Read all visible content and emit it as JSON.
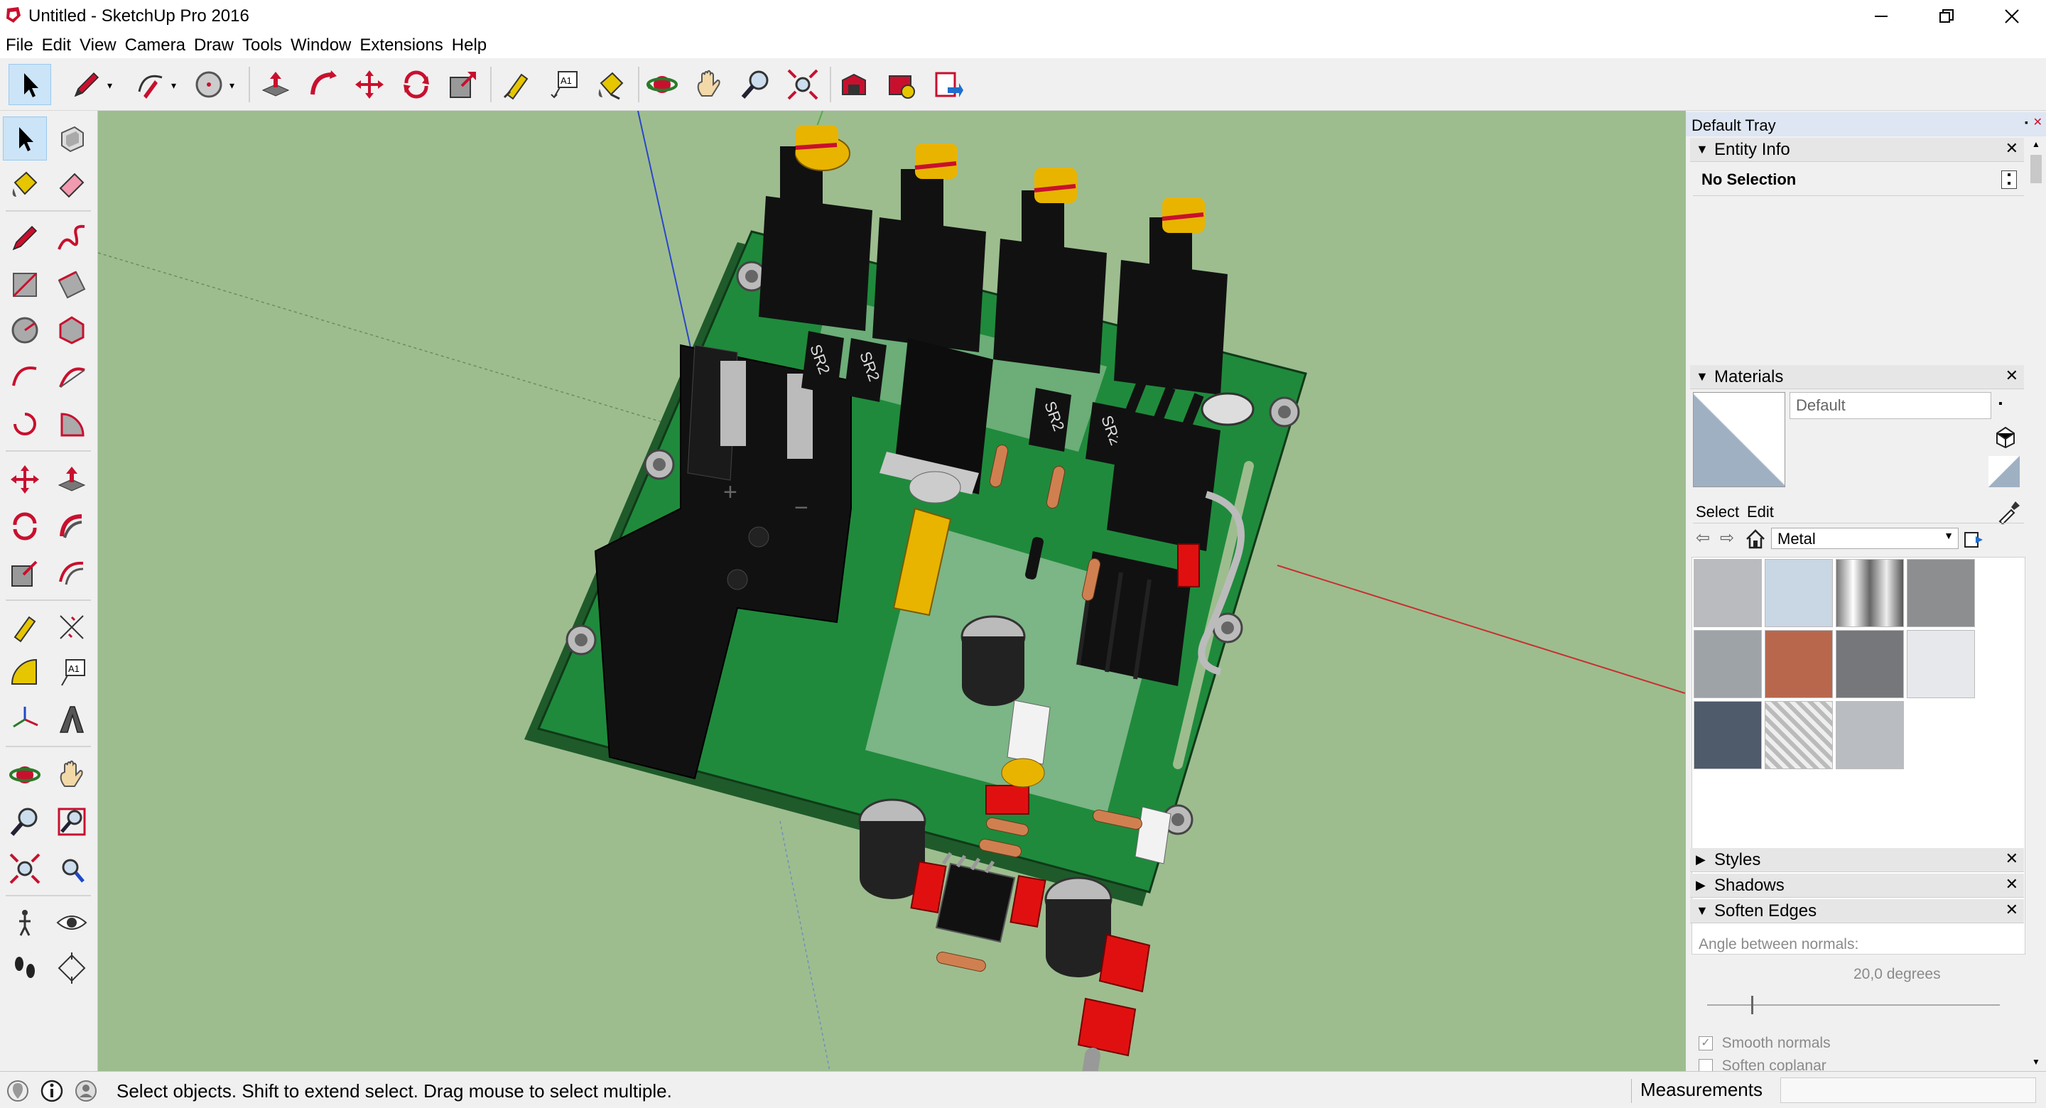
{
  "window": {
    "title": "Untitled - SketchUp Pro 2016"
  },
  "menu": [
    "File",
    "Edit",
    "View",
    "Camera",
    "Draw",
    "Tools",
    "Window",
    "Extensions",
    "Help"
  ],
  "toolbar": {
    "icons": [
      "select-icon",
      "pencil-line-icon",
      "arc-icon",
      "circle-icon",
      "push-pull-icon",
      "follow-me-icon",
      "move-icon",
      "rotate-icon",
      "scale-icon",
      "tape-measure-icon",
      "text-icon",
      "paint-bucket-icon",
      "orbit-icon",
      "pan-icon",
      "zoom-icon",
      "zoom-extents-icon",
      "warehouse-icon",
      "extension-warehouse-icon",
      "layout-icon"
    ],
    "text_icon_label": "A1"
  },
  "left_toolbar": {
    "icons": [
      "select-icon",
      "make-component-icon",
      "paint-bucket-icon",
      "eraser-icon",
      "line-icon",
      "freehand-icon",
      "rectangle-icon",
      "rotated-rectangle-icon",
      "circle-icon",
      "polygon-icon",
      "arc-icon",
      "two-point-arc-icon",
      "three-point-arc-icon",
      "pie-icon",
      "move-icon",
      "push-pull-icon",
      "rotate-icon",
      "follow-me-icon",
      "scale-icon",
      "offset-icon",
      "tape-measure-icon",
      "dimension-icon",
      "protractor-icon",
      "text-icon",
      "axes-icon",
      "3d-text-icon",
      "orbit-icon",
      "pan-icon",
      "zoom-icon",
      "zoom-window-icon",
      "zoom-extents-icon",
      "previous-view-icon",
      "position-camera-icon",
      "look-around-icon",
      "walk-icon",
      "section-plane-icon"
    ],
    "text_icon_label": "A1"
  },
  "tray": {
    "title": "Default Tray",
    "entity_info": {
      "header": "Entity Info",
      "selection": "No Selection"
    },
    "materials": {
      "header": "Materials",
      "material_name": "Default",
      "tab_select": "Select",
      "tab_edit": "Edit",
      "library": "Metal",
      "swatches": [
        "#b9bbbe",
        "#c9d6e3",
        "#9a9a9a",
        "#8c8e90",
        "#9ea3a8",
        "#b8674d",
        "#75777a",
        "#e6e8ec",
        "#4f5a6b",
        "#c4c6c8",
        "#b9bdc1"
      ]
    },
    "styles": {
      "header": "Styles"
    },
    "shadows": {
      "header": "Shadows"
    },
    "soften_edges": {
      "header": "Soften Edges",
      "angle_label": "Angle between normals:",
      "angle_value": "20,0  degrees",
      "slider_fraction": 0.15,
      "smooth_normals": "Smooth normals",
      "smooth_normals_checked": true,
      "soften_coplanar": "Soften coplanar",
      "soften_coplanar_checked": false
    }
  },
  "status": {
    "message": "Select objects. Shift to extend select. Drag mouse to select multiple.",
    "measurements_label": "Measurements"
  },
  "model": {
    "resistor_labels": [
      "SR2",
      "SR2",
      "SR2",
      "SR2"
    ],
    "polarity_plus": "+",
    "polarity_minus": "−"
  }
}
